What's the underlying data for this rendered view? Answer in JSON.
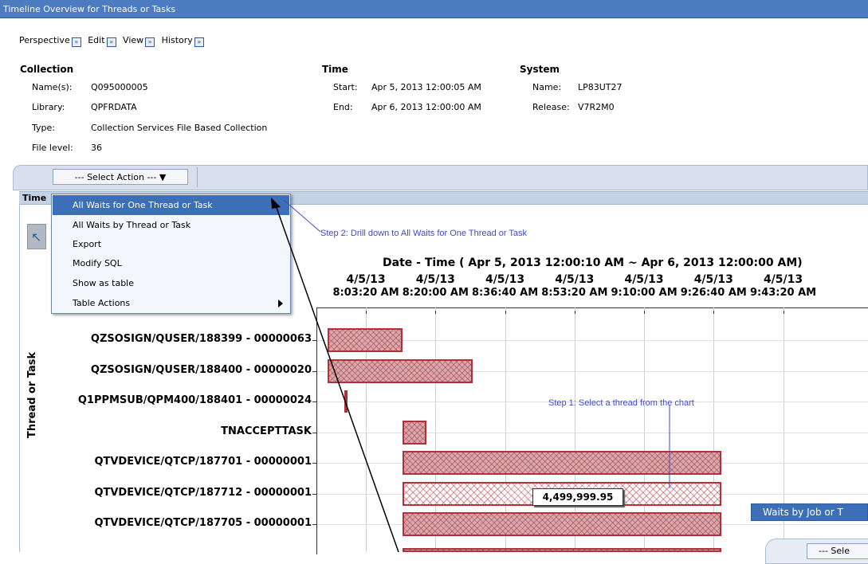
{
  "window": {
    "title": "Timeline Overview for Threads or Tasks"
  },
  "menu": [
    "Perspective",
    "Edit",
    "View",
    "History"
  ],
  "collection": {
    "heading": "Collection",
    "name_label": "Name(s):",
    "name": "Q095000005",
    "library_label": "Library:",
    "library": "QPFRDATA",
    "type_label": "Type:",
    "type": "Collection Services File Based Collection",
    "file_level_label": "File level:",
    "file_level": "36"
  },
  "time": {
    "heading": "Time",
    "start_label": "Start:",
    "start": "Apr 5, 2013 12:00:05 AM",
    "end_label": "End:",
    "end": "Apr 6, 2013 12:00:00 AM"
  },
  "system": {
    "heading": "System",
    "name_label": "Name:",
    "name": "LP83UT27",
    "release_label": "Release:",
    "release": "V7R2M0"
  },
  "toolbar": {
    "select_action": "--- Select Action --- ▼"
  },
  "section": {
    "title": "Time"
  },
  "dropdown": {
    "items": [
      "All Waits for One Thread or Task",
      "All Waits by Thread or Task",
      "Export",
      "Modify SQL",
      "Show as table",
      "Table Actions"
    ]
  },
  "annotations": {
    "step2": "Step 2: Drill down to All Waits for One Thread or Task",
    "step1": "Step 1: Select a thread from the chart"
  },
  "tooltip": "4,499,999.95",
  "waits_window": {
    "title": "Waits by Job or T",
    "select": "--- Sele"
  },
  "chart_data": {
    "type": "bar",
    "orientation": "horizontal",
    "title": "Date - Time ( Apr 5, 2013 12:00:10 AM ~ Apr 6, 2013 12:00:00 AM)",
    "ylabel": "Thread or Task",
    "x_ticks": [
      {
        "date": "4/5/13",
        "time": "8:03:20 AM"
      },
      {
        "date": "4/5/13",
        "time": "8:20:00 AM"
      },
      {
        "date": "4/5/13",
        "time": "8:36:40 AM"
      },
      {
        "date": "4/5/13",
        "time": "8:53:20 AM"
      },
      {
        "date": "4/5/13",
        "time": "9:10:00 AM"
      },
      {
        "date": "4/5/13",
        "time": "9:26:40 AM"
      },
      {
        "date": "4/5/13",
        "time": "9:43:20 AM"
      }
    ],
    "xlim": [
      "7:51:40 AM",
      "10:03:40 AM"
    ],
    "grid": true,
    "categories": [
      "QZSOSIGN/QUSER/188399 - 00000063",
      "QZSOSIGN/QUSER/188400 - 00000020",
      "Q1PPMSUB/QPM400/188401 - 00000024",
      "TNACCEPTTASK",
      "QTVDEVICE/QTCP/187701 - 00000001",
      "QTVDEVICE/QTCP/187712 - 00000001",
      "QTVDEVICE/QTCP/187705 - 00000001"
    ],
    "intervals": [
      {
        "start": "7:54:10 AM",
        "end": "8:12:10 AM"
      },
      {
        "start": "7:54:10 AM",
        "end": "8:28:50 AM"
      },
      {
        "start": "7:58:10 AM",
        "end": "7:59:00 AM"
      },
      {
        "start": "8:12:10 AM",
        "end": "8:17:50 AM"
      },
      {
        "start": "8:12:10 AM",
        "end": "9:28:30 AM"
      },
      {
        "start": "8:12:10 AM",
        "end": "9:28:30 AM",
        "selected": true
      },
      {
        "start": "8:12:10 AM",
        "end": "9:28:30 AM"
      }
    ],
    "colors": {
      "bar_border": "#b2303a",
      "bar_fill": "#d9a8ac"
    }
  }
}
